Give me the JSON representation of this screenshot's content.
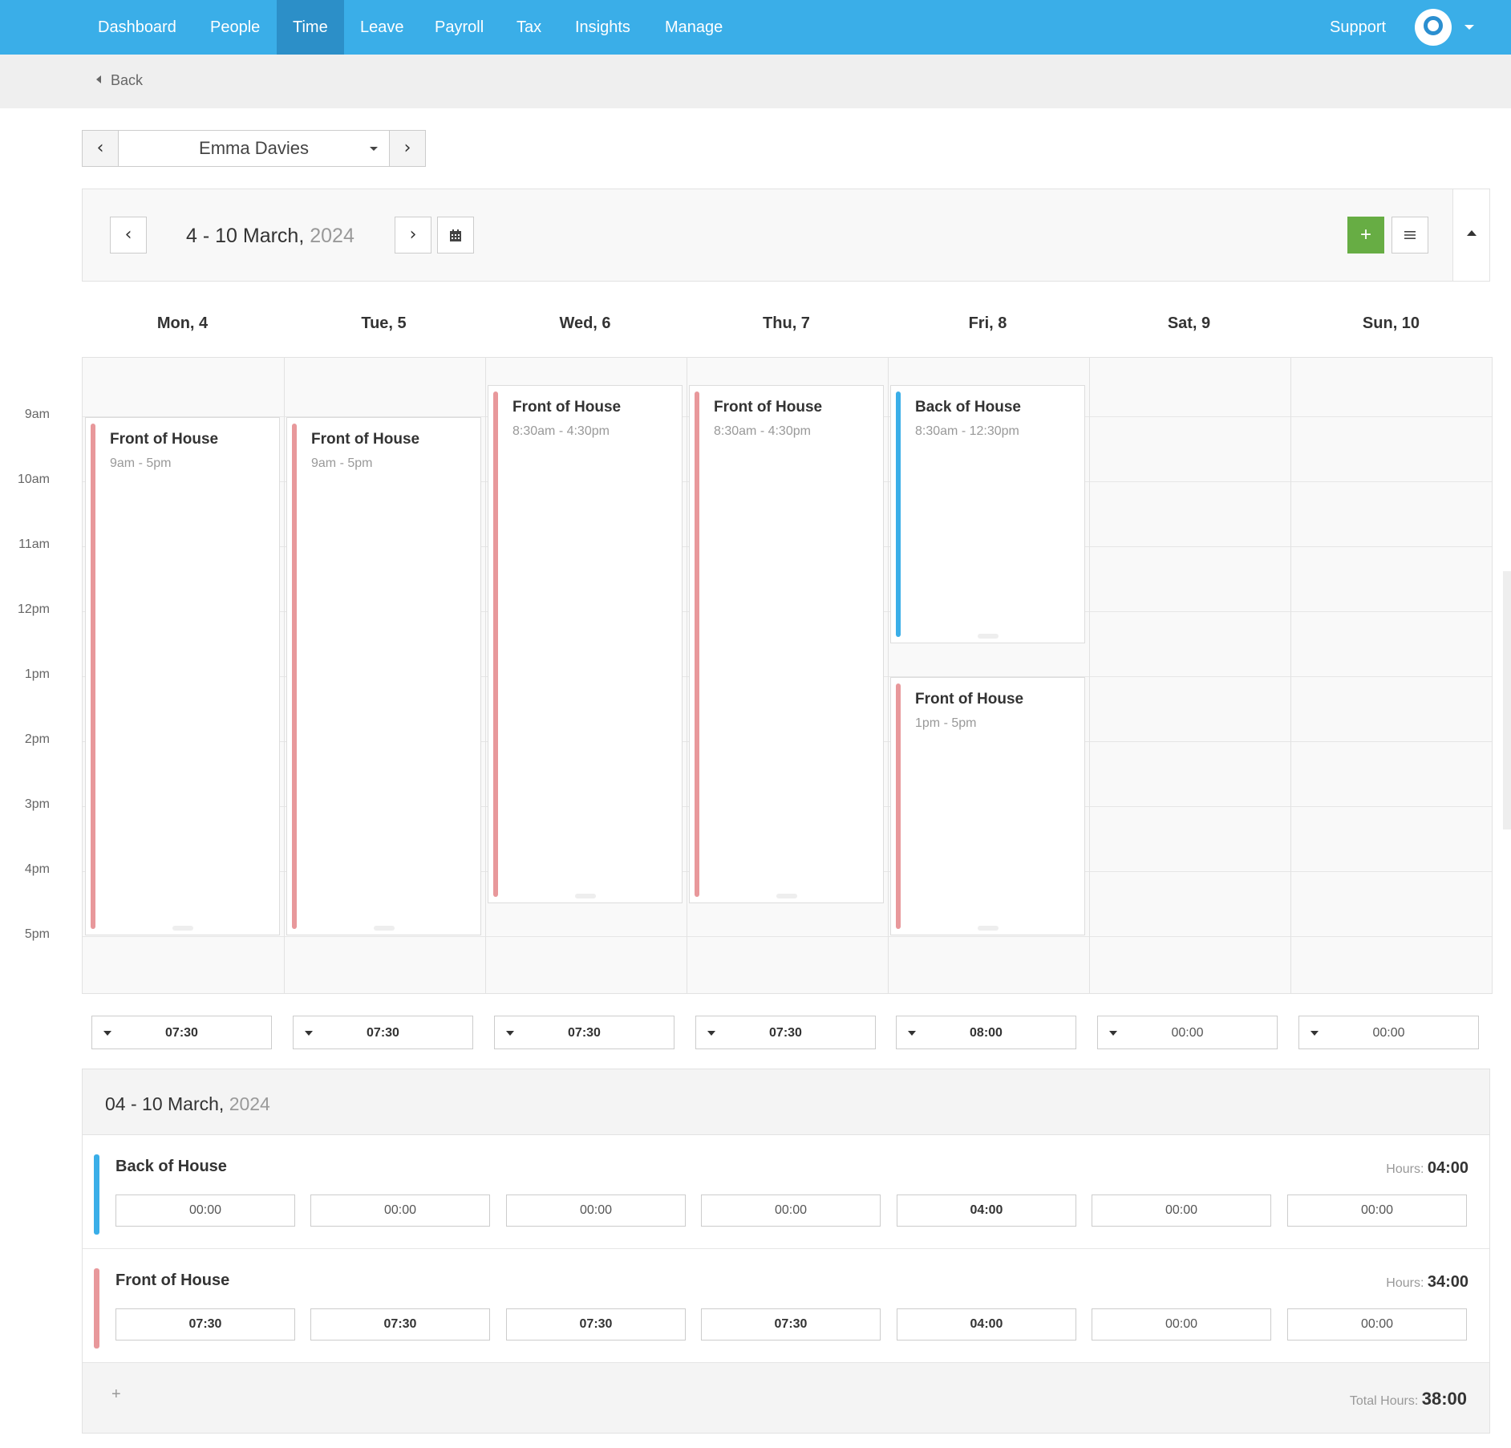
{
  "nav": {
    "items": [
      {
        "label": "Dashboard",
        "active": false
      },
      {
        "label": "People",
        "active": false
      },
      {
        "label": "Time",
        "active": true
      },
      {
        "label": "Leave",
        "active": false
      },
      {
        "label": "Payroll",
        "active": false
      },
      {
        "label": "Tax",
        "active": false
      },
      {
        "label": "Insights",
        "active": false
      },
      {
        "label": "Manage",
        "active": false
      }
    ],
    "support": "Support",
    "accent": "#3aaee8"
  },
  "back_label": "Back",
  "employee": {
    "name": "Emma Davies"
  },
  "week": {
    "range": "4 - 10 March,",
    "year": "2024"
  },
  "days": [
    "Mon, 4",
    "Tue, 5",
    "Wed, 6",
    "Thu, 7",
    "Fri, 8",
    "Sat, 9",
    "Sun, 10"
  ],
  "time_labels": [
    "9am",
    "10am",
    "11am",
    "12pm",
    "1pm",
    "2pm",
    "3pm",
    "4pm",
    "5pm"
  ],
  "shifts": [
    {
      "day": 0,
      "title": "Front of House",
      "time": "9am - 5pm",
      "start": 9,
      "end": 17,
      "color": "#e8989b"
    },
    {
      "day": 1,
      "title": "Front of House",
      "time": "9am - 5pm",
      "start": 9,
      "end": 17,
      "color": "#e8989b"
    },
    {
      "day": 2,
      "title": "Front of House",
      "time": "8:30am - 4:30pm",
      "start": 8.5,
      "end": 16.5,
      "color": "#e8989b"
    },
    {
      "day": 3,
      "title": "Front of House",
      "time": "8:30am - 4:30pm",
      "start": 8.5,
      "end": 16.5,
      "color": "#e8989b"
    },
    {
      "day": 4,
      "title": "Back of House",
      "time": "8:30am - 12:30pm",
      "start": 8.5,
      "end": 12.5,
      "color": "#3aaee8"
    },
    {
      "day": 4,
      "title": "Front of House",
      "time": "1pm - 5pm",
      "start": 13,
      "end": 17,
      "color": "#e8989b"
    }
  ],
  "day_totals": [
    "07:30",
    "07:30",
    "07:30",
    "07:30",
    "08:00",
    "00:00",
    "00:00"
  ],
  "summary": {
    "range": "04 - 10 March,",
    "year": "2024",
    "hours_label": "Hours:",
    "categories": [
      {
        "name": "Back of House",
        "color": "#3aaee8",
        "hours": "04:00",
        "values": [
          "00:00",
          "00:00",
          "00:00",
          "00:00",
          "04:00",
          "00:00",
          "00:00"
        ]
      },
      {
        "name": "Front of House",
        "color": "#e8989b",
        "hours": "34:00",
        "values": [
          "07:30",
          "07:30",
          "07:30",
          "07:30",
          "04:00",
          "00:00",
          "00:00"
        ]
      }
    ],
    "total_label": "Total Hours:",
    "total": "38:00"
  }
}
